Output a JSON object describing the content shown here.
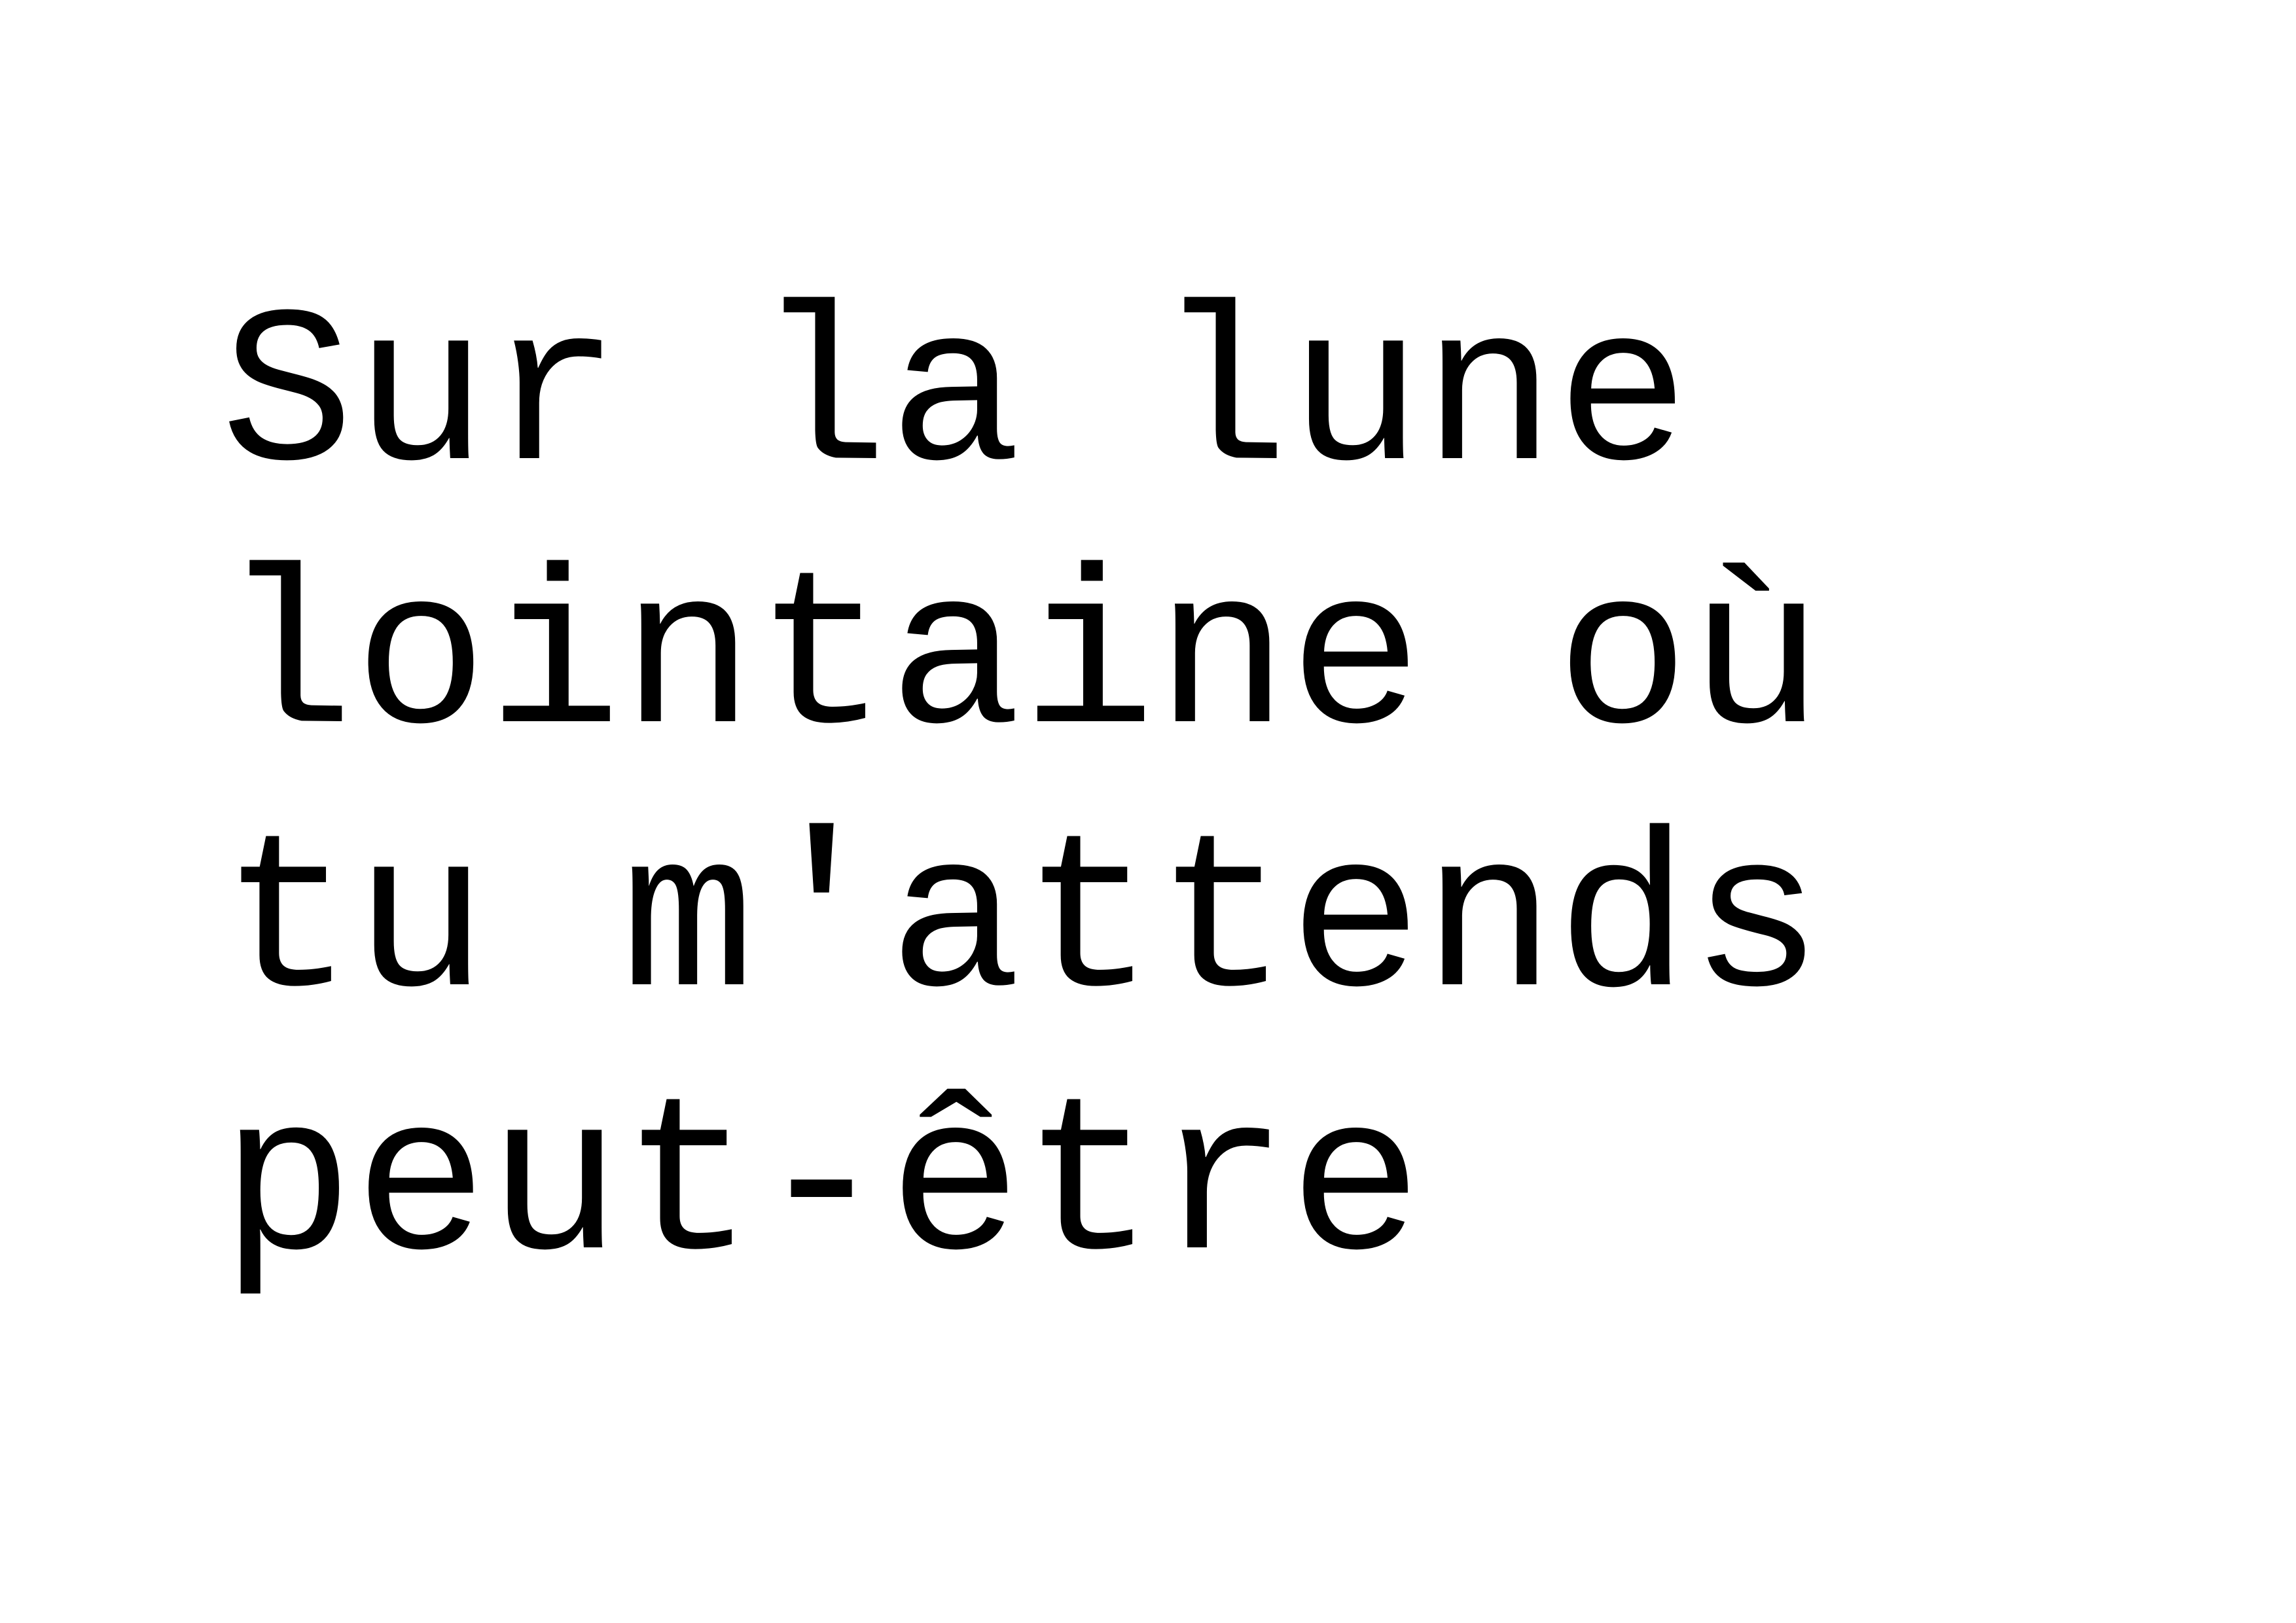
{
  "text_color": "#000000",
  "background_color": "#ffffff",
  "lines": [
    "Sur la lune",
    "lointaine où",
    "tu m'attends",
    "peut-être"
  ]
}
